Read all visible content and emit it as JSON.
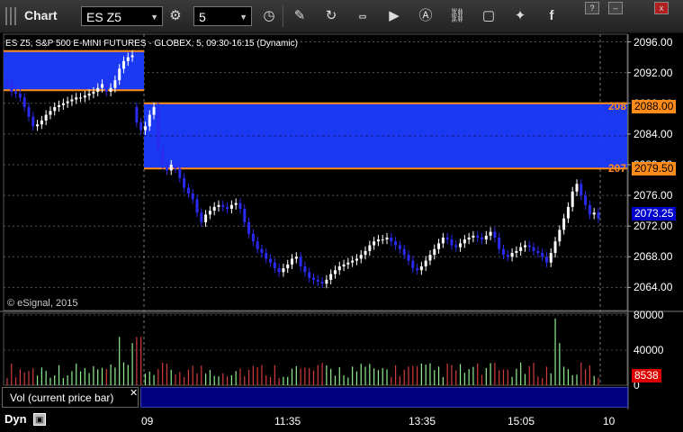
{
  "toolbar": {
    "title": "Chart",
    "symbol": "ES Z5",
    "interval": "5",
    "icons": [
      "grid-icon",
      "settings-gear-icon",
      "clock-icon",
      "pencil-draw-icon",
      "refresh-icon",
      "get-quotes-icon",
      "play-icon",
      "alert-icon",
      "link-icon",
      "comment-icon",
      "twitter-icon",
      "facebook-icon"
    ]
  },
  "window_buttons": [
    "help",
    "minimize",
    "close"
  ],
  "window_button_glyphs": [
    "?",
    "–",
    "x"
  ],
  "chart_info": "ES Z5, S&P 500 E-MINI FUTURES - GLOBEX, 5, 09:30-16:15 (Dynamic)",
  "copyright": "© eSignal, 2015",
  "colors": {
    "up": "#ffffff",
    "down": "#2a2af0",
    "zone_fill": "#1e3cff",
    "zone_line": "#ff8c1a",
    "vol_up": "#90ee90",
    "vol_down": "#d23c3c",
    "current_price_bg": "#0000cc",
    "current_vol_bg": "#dd0000"
  },
  "chart_data": [
    {
      "type": "candlestick",
      "title": "ES Z5, S&P 500 E-MINI FUTURES - GLOBEX, 5, 09:30-16:15 (Dynamic)",
      "ylim": [
        2061,
        2097
      ],
      "yticks": [
        "2096.00",
        "2092.00",
        "2088.00",
        "2084.00",
        "2080.00",
        "2076.00",
        "2072.00",
        "2068.00",
        "2064.00"
      ],
      "xticks": [
        "09",
        "11:35",
        "13:35",
        "15:05",
        "10"
      ],
      "zones": [
        {
          "start_bar": 0,
          "end_bar": 30,
          "top": 2094.8,
          "bottom": 2089.7
        },
        {
          "start_bar": 30,
          "end_bar": 130,
          "top": 2088.0,
          "bottom": 2079.5
        }
      ],
      "zone_labels": [
        {
          "price": "2088.00",
          "left_text": "208"
        },
        {
          "price": "2079.50",
          "left_text": "207"
        }
      ],
      "current_price": "2073.25",
      "closes": [
        2090.5,
        2089.5,
        2089.25,
        2088.75,
        2087.5,
        2086.25,
        2085.0,
        2085.25,
        2085.75,
        2086.5,
        2087.0,
        2087.5,
        2087.75,
        2088.0,
        2088.25,
        2088.5,
        2088.75,
        2088.75,
        2089.0,
        2089.25,
        2089.5,
        2090.0,
        2090.5,
        2089.5,
        2090.0,
        2091.0,
        2092.5,
        2093.5,
        2094.0,
        2094.25,
        2085.5,
        2084.5,
        2085.0,
        2086.5,
        2087.5,
        2082.0,
        2080.0,
        2079.25,
        2080.0,
        2079.5,
        2078.25,
        2077.0,
        2076.25,
        2075.5,
        2073.75,
        2072.5,
        2073.5,
        2074.0,
        2074.5,
        2074.75,
        2074.5,
        2074.25,
        2074.75,
        2075.0,
        2074.25,
        2072.5,
        2071.0,
        2070.0,
        2069.0,
        2068.5,
        2067.75,
        2067.25,
        2066.5,
        2066.0,
        2066.5,
        2067.0,
        2067.75,
        2068.0,
        2066.75,
        2066.0,
        2065.25,
        2065.0,
        2064.75,
        2064.5,
        2065.0,
        2065.75,
        2066.25,
        2066.75,
        2067.0,
        2067.25,
        2067.5,
        2067.75,
        2068.25,
        2068.75,
        2069.5,
        2070.0,
        2070.25,
        2070.25,
        2070.5,
        2070.0,
        2069.5,
        2069.0,
        2068.25,
        2067.5,
        2066.5,
        2066.25,
        2066.75,
        2067.5,
        2068.25,
        2069.0,
        2069.75,
        2070.5,
        2070.25,
        2069.5,
        2069.25,
        2069.75,
        2070.25,
        2070.5,
        2070.75,
        2070.5,
        2070.25,
        2070.75,
        2071.25,
        2070.5,
        2069.0,
        2068.25,
        2068.0,
        2068.5,
        2068.75,
        2069.25,
        2069.5,
        2069.25,
        2068.75,
        2068.5,
        2068.0,
        2067.25,
        2068.5,
        2070.0,
        2071.5,
        2073.0,
        2074.5,
        2076.5,
        2077.5,
        2076.0,
        2074.75,
        2073.5,
        2073.75,
        2073.0
      ],
      "volume": {
        "ylim": [
          0,
          82000
        ],
        "yticks": [
          "80000",
          "40000",
          "0"
        ],
        "current_value": "8538",
        "legend": "Vol (current price bar)"
      }
    }
  ],
  "bottom": {
    "dyn_label": "Dyn"
  }
}
